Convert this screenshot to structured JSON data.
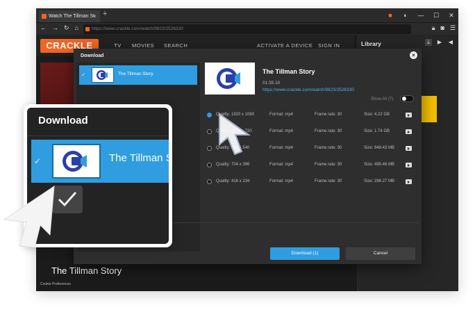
{
  "browser": {
    "tab_title": "Watch The Tillman St",
    "tab_close": "×",
    "new_tab": "+",
    "url": "https://www.crackle.com/watch/9823/2526330",
    "nav": {
      "back": "←",
      "forward": "→",
      "reload": "↻",
      "home": "⌂"
    }
  },
  "crackle": {
    "logo": "CRACKLE",
    "nav_items": [
      "TV",
      "MOVIES",
      "SEARCH"
    ],
    "activate": "ACTIVATE A DEVICE",
    "sign_in": "SIGN IN",
    "page_title": "The Tillman Story",
    "cookie": "Cookie Preferences"
  },
  "library": {
    "title": "Library"
  },
  "dialog": {
    "title": "Download",
    "close": "×",
    "list_item_title": "The Tillman Story",
    "video": {
      "title": "The Tillman Story",
      "duration": "01:35:10",
      "url": "https://www.crackle.com/watch/9823/2526330"
    },
    "show_all": "Show All (7)",
    "qualities": [
      {
        "quality": "Quality: 1920 x 1080",
        "format": "Format: mp4",
        "framerate": "Frame rate: 30",
        "size": "Size: 4.22 GB",
        "selected": true
      },
      {
        "quality": "Quality: 1280 x 720",
        "format": "Format: mp4",
        "framerate": "Frame rate: 30",
        "size": "Size: 1.74 GB",
        "selected": false
      },
      {
        "quality": "Quality: 960 x 540",
        "format": "Format: mp4",
        "framerate": "Frame rate: 30",
        "size": "Size: 848.43 MB",
        "selected": false
      },
      {
        "quality": "Quality: 704 x 396",
        "format": "Format: mp4",
        "framerate": "Frame rate: 30",
        "size": "Size: 489.46 MB",
        "selected": false
      },
      {
        "quality": "Quality: 416 x 234",
        "format": "Format: mp4",
        "framerate": "Frame rate: 30",
        "size": "Size: 286.27 MB",
        "selected": false
      }
    ],
    "download_button": "Download (1)",
    "cancel_button": "Cancel"
  },
  "zoom": {
    "title": "Download",
    "item_title": "The Tillman St"
  },
  "colors": {
    "accent": "#2f9de0",
    "brand": "#f26522",
    "dialog_bg": "#2e2e2e"
  }
}
